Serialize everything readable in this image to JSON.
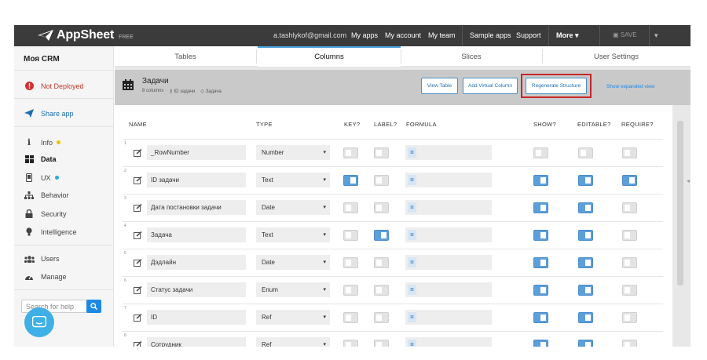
{
  "topbar": {
    "logo": "AppSheet",
    "badge": "FREE",
    "email": "a.tashlykof@gmail.com",
    "links": [
      "My apps",
      "My account",
      "My team",
      "Sample apps",
      "Support"
    ],
    "more": "More",
    "save": "SAVE",
    "colors": {
      "bar": "#3b3b3b",
      "accent": "#1e88e5"
    }
  },
  "sidebar": {
    "app_name": "Моя CRM",
    "status": "Not Deployed",
    "share": "Share app",
    "items": [
      {
        "label": "Info",
        "icon": "info-icon",
        "dot": "#f2c200"
      },
      {
        "label": "Data",
        "icon": "grid-icon",
        "active": true
      },
      {
        "label": "UX",
        "icon": "phone-icon",
        "dot": "#2aa8e0"
      },
      {
        "label": "Behavior",
        "icon": "sitemap-icon"
      },
      {
        "label": "Security",
        "icon": "lock-icon"
      },
      {
        "label": "Intelligence",
        "icon": "bulb-icon"
      }
    ],
    "bottom_items": [
      {
        "label": "Users",
        "icon": "users-icon"
      },
      {
        "label": "Manage",
        "icon": "dashboard-icon"
      }
    ],
    "search_placeholder": "Search for help"
  },
  "tabs": [
    "Tables",
    "Columns",
    "Slices",
    "User Settings"
  ],
  "active_tab": "Columns",
  "table": {
    "name": "Задачи",
    "columns_count": "8 columns",
    "key": "ID задачи",
    "label": "Задача",
    "buttons": {
      "view": "View Table",
      "virtual": "Add Virtual Column",
      "regen": "Regenerate Structure",
      "expand": "Show expanded view"
    }
  },
  "headers": {
    "name": "NAME",
    "type": "TYPE",
    "key": "KEY?",
    "label": "LABEL?",
    "formula": "FORMULA",
    "show": "SHOW?",
    "editable": "EDITABLE?",
    "require": "REQUIRE?"
  },
  "rows": [
    {
      "num": "1",
      "name": "_RowNumber",
      "type": "Number",
      "key": false,
      "label": false,
      "show": false,
      "editable": false,
      "require": false
    },
    {
      "num": "2",
      "name": "ID задачи",
      "type": "Text",
      "key": true,
      "label": false,
      "show": true,
      "editable": true,
      "require": true
    },
    {
      "num": "3",
      "name": "Дата постановки задачи",
      "type": "Date",
      "key": false,
      "label": false,
      "show": true,
      "editable": true,
      "require": false
    },
    {
      "num": "4",
      "name": "Задача",
      "type": "Text",
      "key": false,
      "label": true,
      "show": true,
      "editable": true,
      "require": false
    },
    {
      "num": "5",
      "name": "Дэдлайн",
      "type": "Date",
      "key": false,
      "label": false,
      "show": true,
      "editable": true,
      "require": false
    },
    {
      "num": "6",
      "name": "Статус задачи",
      "type": "Enum",
      "key": false,
      "label": false,
      "show": true,
      "editable": true,
      "require": false
    },
    {
      "num": "7",
      "name": "ID",
      "type": "Ref",
      "key": false,
      "label": false,
      "show": true,
      "editable": true,
      "require": false
    },
    {
      "num": "8",
      "name": "Сотрудник",
      "type": "Ref",
      "key": false,
      "label": false,
      "show": true,
      "editable": true,
      "require": false
    }
  ]
}
